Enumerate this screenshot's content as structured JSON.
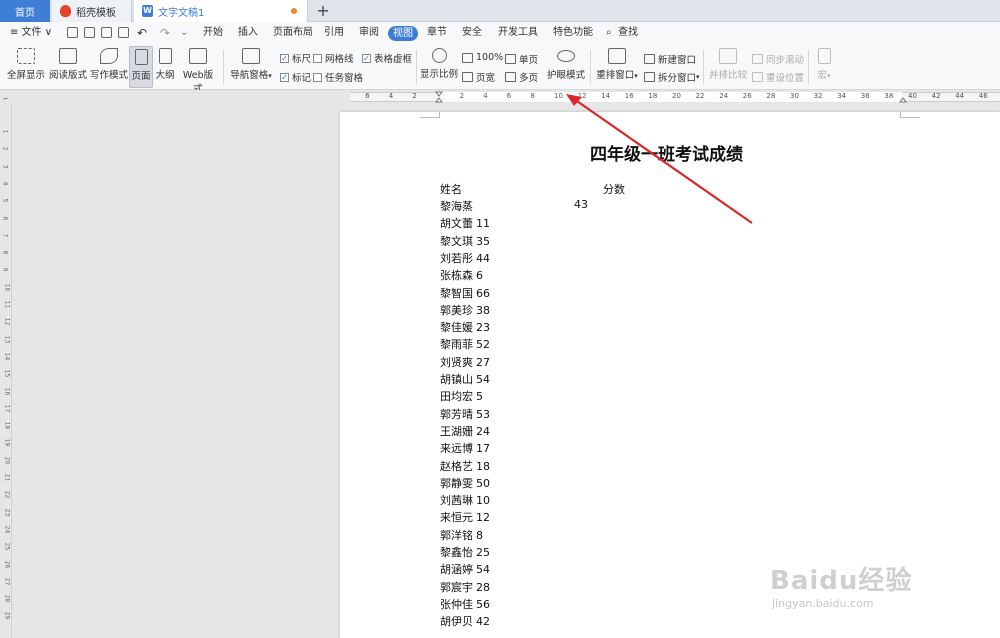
{
  "tabs": [
    {
      "label": "首页"
    },
    {
      "label": "稻壳模板"
    },
    {
      "label": "文字文稿1"
    }
  ],
  "new_tab_symbol": "+",
  "menu": {
    "file": "≡ 文件 ∨",
    "items": [
      "开始",
      "插入",
      "页面布局",
      "引用",
      "审阅",
      "视图",
      "章节",
      "安全",
      "开发工具",
      "特色功能"
    ],
    "active": "视图",
    "search": "查找"
  },
  "ribbon": {
    "fullscreen": "全屏显示",
    "reading": "阅读版式",
    "writing": "写作模式",
    "page": "页面",
    "outline": "大纲",
    "web": "Web版式",
    "nav_pane": "导航窗格",
    "ruler": "标尺",
    "gridlines": "网格线",
    "table_gridlines": "表格虚框",
    "marks": "标记",
    "task_pane": "任务窗格",
    "zoom": "显示比例",
    "zoom_100": "100%",
    "page_width": "页宽",
    "single_page": "单页",
    "multi_page": "多页",
    "eye_mode": "护眼模式",
    "arrange": "重排窗口",
    "new_window": "新建窗口",
    "split_window": "拆分窗口",
    "side_by_side": "并排比较",
    "sync_scroll": "同步滚动",
    "reset_pos": "重设位置",
    "macro": "宏"
  },
  "ruler": {
    "labels": [
      "6",
      "4",
      "2",
      "2",
      "4",
      "6",
      "8",
      "10",
      "12",
      "14",
      "16",
      "18",
      "20",
      "22",
      "24",
      "26",
      "28",
      "30",
      "32",
      "34",
      "36",
      "38",
      "40",
      "42",
      "44",
      "46"
    ],
    "vertical": [
      "1",
      "2",
      "3",
      "4",
      "5",
      "6",
      "7",
      "8",
      "9",
      "10",
      "11",
      "12",
      "13",
      "14",
      "15",
      "16",
      "17",
      "18",
      "19",
      "20",
      "21",
      "22",
      "23",
      "24",
      "25",
      "26",
      "27",
      "28",
      "29"
    ]
  },
  "document": {
    "title": "四年级一班考试成绩",
    "header_name": "姓名",
    "header_score": "分数",
    "rows": [
      {
        "name": "黎海蒸",
        "score": "43"
      },
      {
        "name": "胡文蕾",
        "score": "11"
      },
      {
        "name": "黎文琪",
        "score": "35"
      },
      {
        "name": "刘若彤",
        "score": "44"
      },
      {
        "name": "张栋森",
        "score": "6"
      },
      {
        "name": "黎智国",
        "score": "66"
      },
      {
        "name": "郭美珍",
        "score": "38"
      },
      {
        "name": "黎佳媛",
        "score": "23"
      },
      {
        "name": "黎雨菲",
        "score": "52"
      },
      {
        "name": "刘贤爽",
        "score": "27"
      },
      {
        "name": "胡镇山",
        "score": "54"
      },
      {
        "name": "田均宏",
        "score": "5"
      },
      {
        "name": "郭芳晴",
        "score": "53"
      },
      {
        "name": "王湖姗",
        "score": "24"
      },
      {
        "name": "来远博",
        "score": "17"
      },
      {
        "name": "赵格艺",
        "score": "18"
      },
      {
        "name": "郭静雯",
        "score": "50"
      },
      {
        "name": "刘茜琳",
        "score": "10"
      },
      {
        "name": "来恒元",
        "score": "12"
      },
      {
        "name": "郭洋铭",
        "score": "8"
      },
      {
        "name": "黎鑫怡",
        "score": "25"
      },
      {
        "name": "胡涵婷",
        "score": "54"
      },
      {
        "name": "郭宸宇",
        "score": " 28"
      },
      {
        "name": "张仲佳",
        "score": " 56"
      },
      {
        "name": "胡伊贝",
        "score": "42"
      }
    ]
  },
  "watermark": {
    "logo": "Baidu经验",
    "url": "jingyan.baidu.com"
  },
  "colors": {
    "accent": "#3e7ed6",
    "arrow": "#d9262b"
  }
}
